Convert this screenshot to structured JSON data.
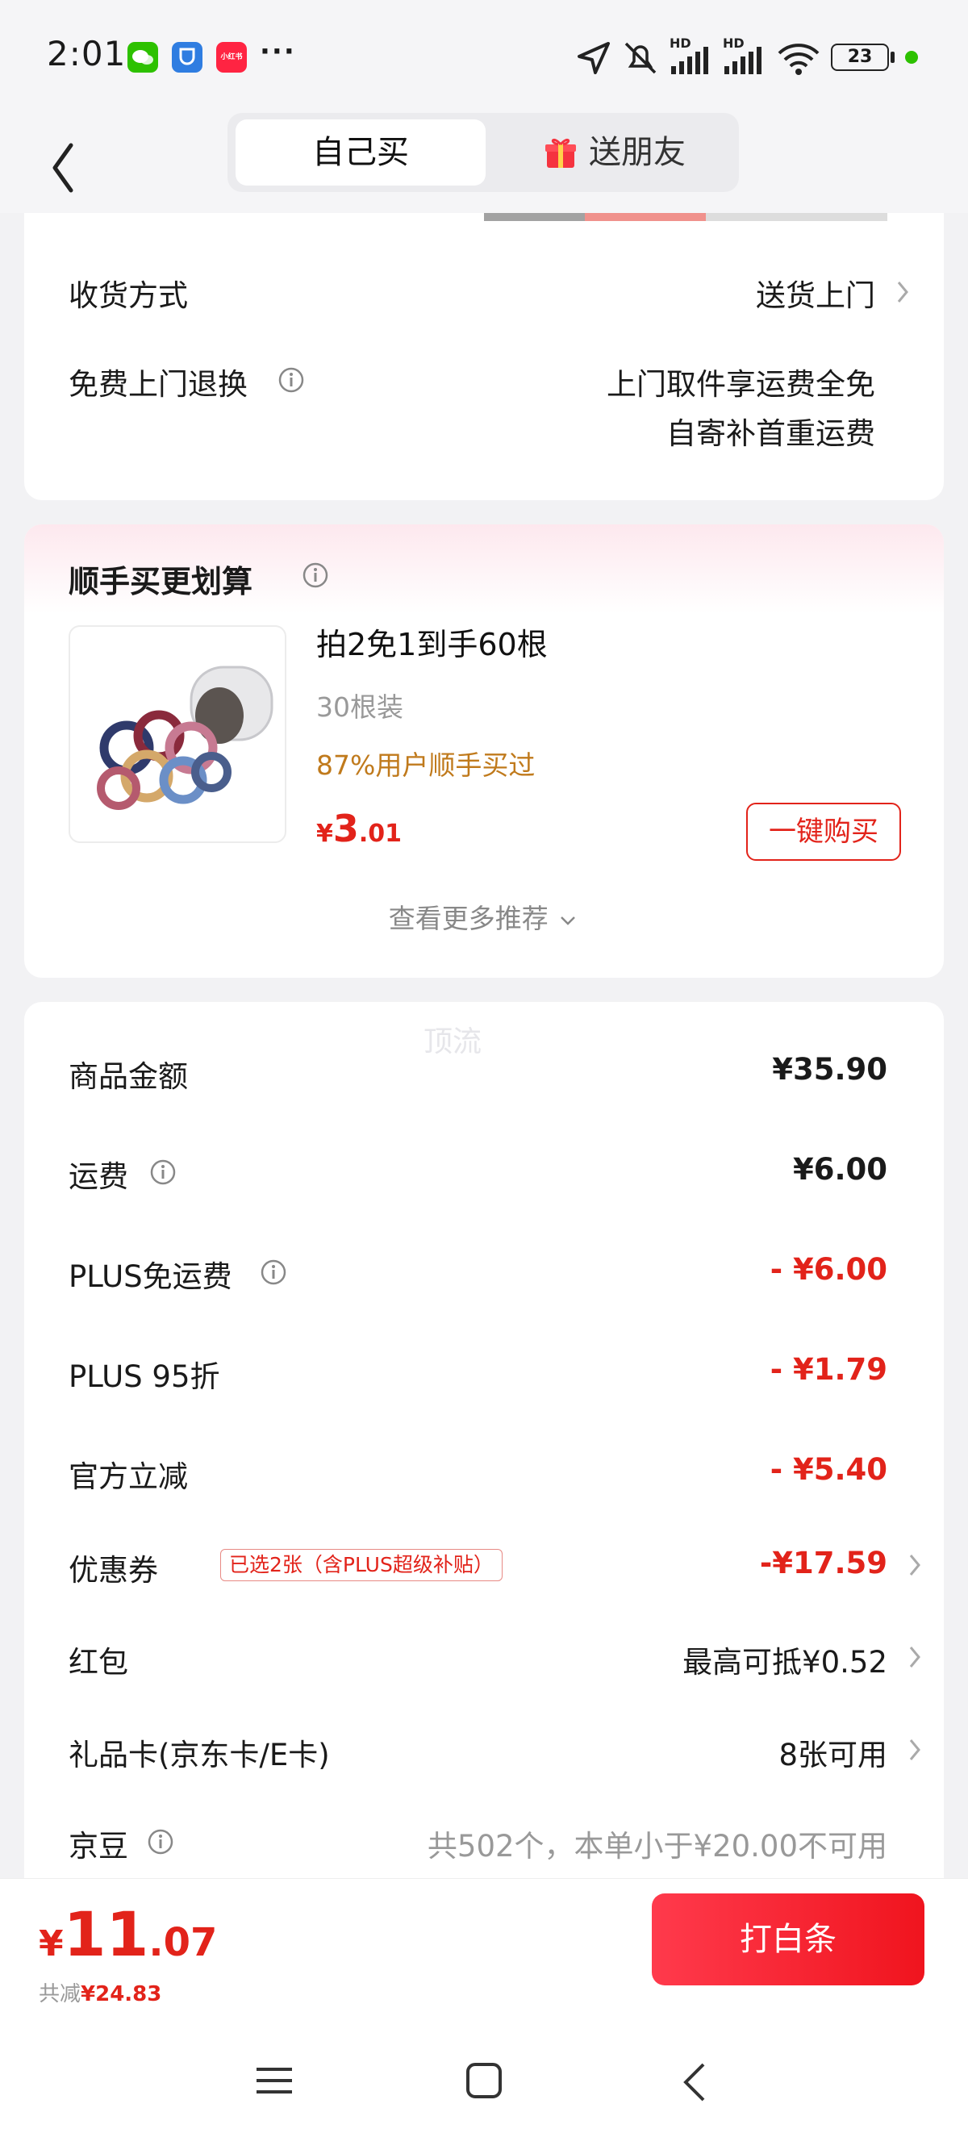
{
  "status_bar": {
    "time": "2:01",
    "battery": "23",
    "apps": [
      "wechat-icon",
      "app-shield-icon",
      "xiaohongshu-icon"
    ],
    "more": "···",
    "hd1": "HD",
    "hd2": "HD",
    "xiaohongshu": "小红书"
  },
  "header": {
    "tab_self": "自己买",
    "tab_gift": "送朋友"
  },
  "delivery": {
    "method_label": "收货方式",
    "method_value": "送货上门",
    "return_label": "免费上门退换",
    "return_line1": "上门取件享运费全免",
    "return_line2": "自寄补首重运费"
  },
  "recommend": {
    "title": "顺手买更划算",
    "product_title": "拍2免1到手60根",
    "product_spec": "30根装",
    "product_social": "87%用户顺手买过",
    "price_symbol": "¥",
    "price_int": "3",
    "price_dec": ".01",
    "buy_button": "一键购买",
    "more": "查看更多推荐"
  },
  "summary": {
    "watermark": "顶流",
    "rows": [
      {
        "label": "商品金额",
        "value": "¥35.90"
      },
      {
        "label": "运费",
        "value": "¥6.00"
      },
      {
        "label": "PLUS免运费",
        "value": "- ¥6.00"
      },
      {
        "label": "PLUS 95折",
        "value": "- ¥1.79"
      },
      {
        "label": "官方立减",
        "value": "- ¥5.40"
      },
      {
        "label": "优惠券",
        "value": "-¥17.59",
        "tag": "已选2张（含PLUS超级补贴）"
      },
      {
        "label": "红包",
        "value": "最高可抵¥0.52"
      },
      {
        "label": "礼品卡(京东卡/E卡)",
        "value": "8张可用"
      },
      {
        "label": "京豆",
        "value": "共502个，本单小于¥20.00不可用"
      }
    ]
  },
  "footer": {
    "price_symbol": "¥",
    "price_int": "11",
    "price_dec": ".07",
    "saved_label": "共减",
    "saved_value": "¥24.83",
    "pay_button": "打白条"
  },
  "colors": {
    "accent_red": "#e2231a",
    "gift_orange": "#c07a1c"
  }
}
